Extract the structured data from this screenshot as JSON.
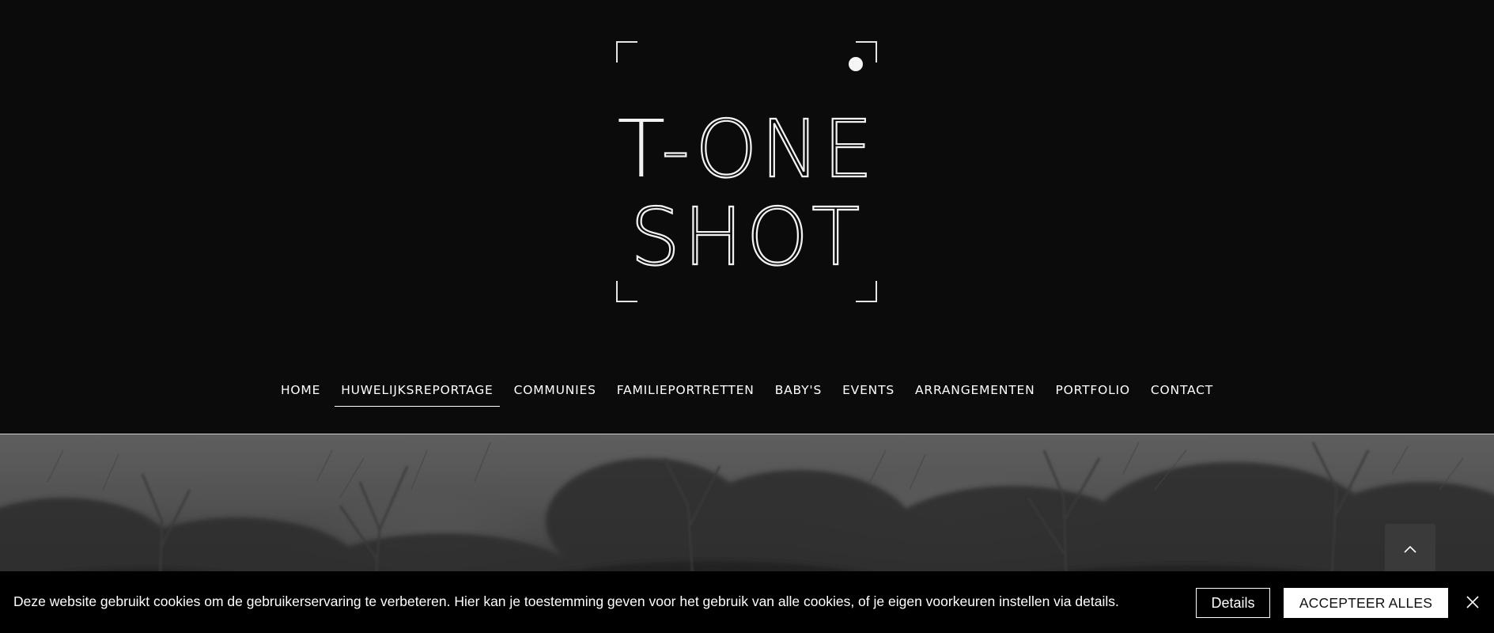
{
  "logo": {
    "line1": "T-ONE",
    "line2": "SHOT",
    "icon": "camera-viewfinder-logo"
  },
  "nav": {
    "items": [
      {
        "label": "HOME",
        "active": false
      },
      {
        "label": "HUWELIJKSREPORTAGE",
        "active": true
      },
      {
        "label": "COMMUNIES",
        "active": false
      },
      {
        "label": "FAMILIEPORTRETTEN",
        "active": false
      },
      {
        "label": "BABY'S",
        "active": false
      },
      {
        "label": "EVENTS",
        "active": false
      },
      {
        "label": "ARRANGEMENTEN",
        "active": false
      },
      {
        "label": "PORTFOLIO",
        "active": false
      },
      {
        "label": "CONTACT",
        "active": false
      }
    ]
  },
  "hero": {
    "icon": "scroll-top-chevron-up-icon"
  },
  "cookie": {
    "text": "Deze website gebruikt cookies om de gebruikerservaring te verbeteren. Hier kan je toestemming geven voor het gebruik van alle cookies, of je eigen voorkeuren instellen via details.",
    "details_label": "Details",
    "accept_label": "ACCEPTEER ALLES",
    "close_icon": "close-icon"
  },
  "colors": {
    "background": "#0b0b0b",
    "text": "#ffffff",
    "cookie_bar": "#000000",
    "accept_button": "#ffffff"
  }
}
